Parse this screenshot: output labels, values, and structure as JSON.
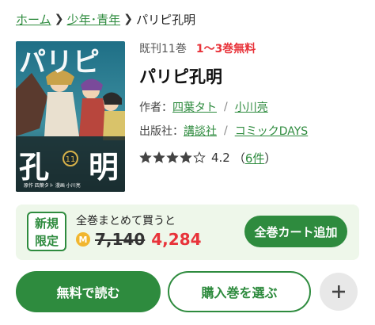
{
  "breadcrumb": {
    "items": [
      {
        "label": "ホーム"
      },
      {
        "label": "少年･青年"
      }
    ],
    "current": "パリピ孔明"
  },
  "cover": {
    "title_text": "パリピ孔明",
    "volume_badge": "11",
    "credits": "原作 四葉タト 漫画 小川亮"
  },
  "book": {
    "volumes_text": "既刊11巻",
    "free_text": "1〜3巻無料",
    "title": "パリピ孔明",
    "author_label": "作者：",
    "authors": [
      "四葉タト",
      "小川亮"
    ],
    "publisher_label": "出版社：",
    "publishers": [
      "講談社",
      "コミックDAYS"
    ],
    "rating": {
      "stars_filled": 4,
      "stars_total": 5,
      "value": "4.2",
      "paren_open": "（",
      "count": "6件",
      "paren_close": "）"
    }
  },
  "promo": {
    "badge_line1": "新規",
    "badge_line2": "限定",
    "label": "全巻まとめて買うと",
    "coin_symbol": "M",
    "old_price": "7,140",
    "new_price": "4,284",
    "cart_button": "全巻カート追加"
  },
  "actions": {
    "read_free": "無料で読む",
    "select_volume": "購入巻を選ぶ"
  },
  "colors": {
    "accent": "#2e8b3e",
    "price_red": "#e8333a",
    "promo_bg": "#eef7ea",
    "coin": "#f1b62f"
  }
}
